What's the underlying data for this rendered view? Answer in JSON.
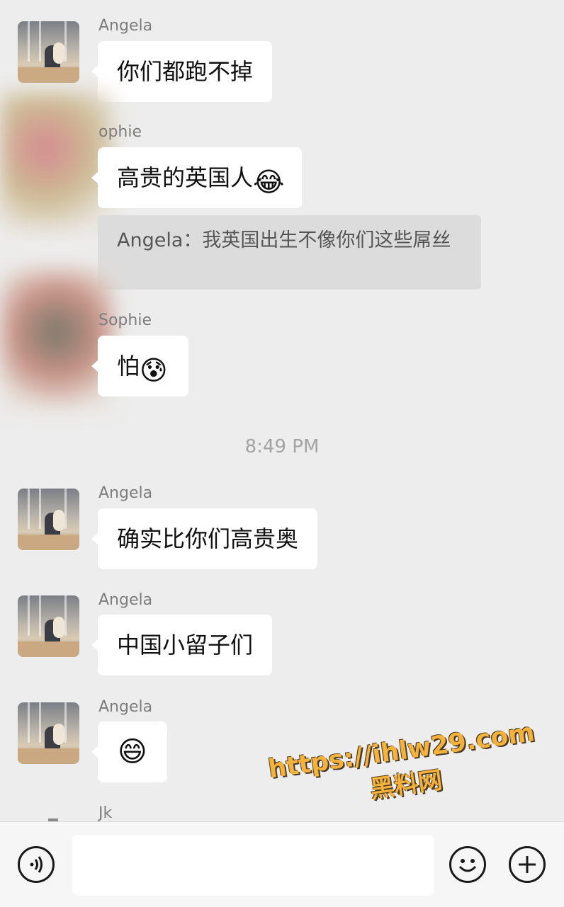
{
  "messages": [
    {
      "sender": "Angela",
      "text": "你们都跑不掉"
    },
    {
      "sender": "Sophie",
      "text": "高贵的英国人",
      "emoji": "😂"
    },
    {
      "quote": "Angela：我英国出生不像你们这些屌丝"
    },
    {
      "sender": "Sophie",
      "text": "怕",
      "emoji": "😰"
    },
    {
      "timestamp": "8:49 PM"
    },
    {
      "sender": "Angela",
      "text": "确实比你们高贵奥"
    },
    {
      "sender": "Angela",
      "text": "中国小留子们"
    },
    {
      "sender": "Angela",
      "emoji": "😄"
    },
    {
      "sender": "Jk"
    }
  ],
  "labels": {
    "angela": "Angela",
    "sophie_partial": "ophie",
    "sophie": "Sophie",
    "jk": "Jk"
  },
  "watermark": {
    "url": "https://ihlw29.com",
    "text": "黑料网"
  },
  "input_bar": {
    "placeholder": "",
    "icons": [
      "voice-icon",
      "emoji-icon",
      "plus-icon"
    ]
  },
  "colors": {
    "background": "#ededed",
    "bubble": "#ffffff",
    "quote_bg": "#dcdcdc",
    "watermark": "#f4b13b"
  }
}
